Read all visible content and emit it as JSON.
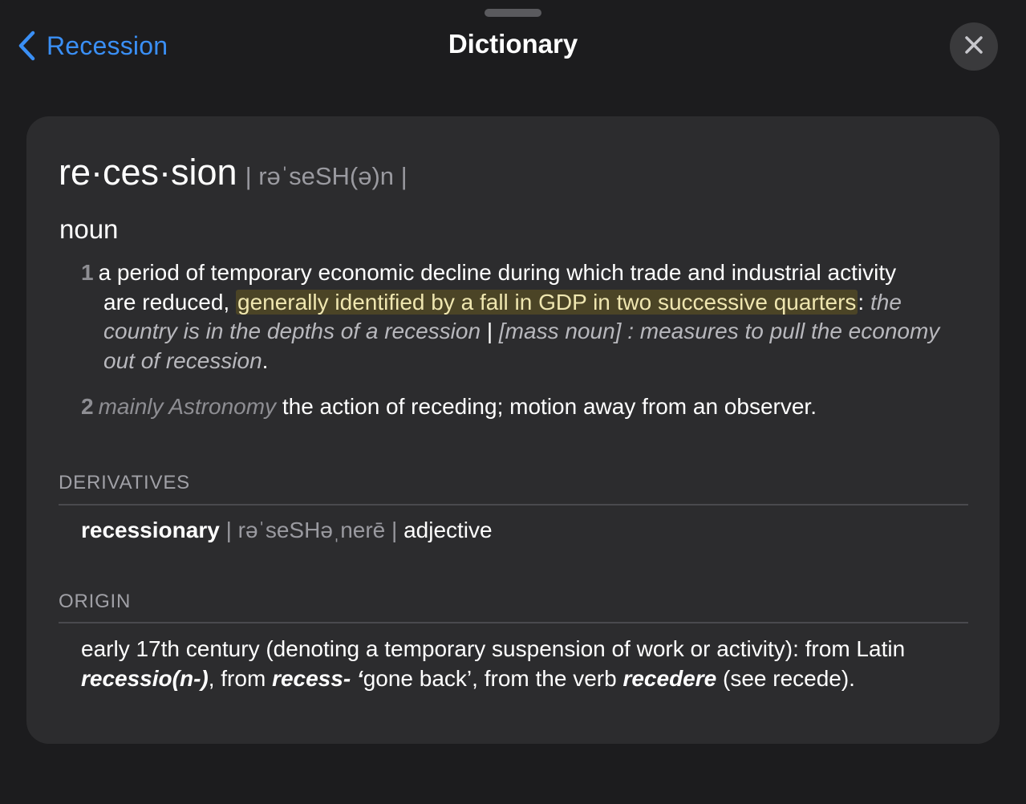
{
  "nav": {
    "back_label": "Recession",
    "title": "Dictionary"
  },
  "entry": {
    "headword": "re·ces·sion",
    "pronunciation": "| rəˈseSH(ə)n |",
    "part_of_speech": "noun",
    "senses": [
      {
        "number": "1",
        "definition_start": "a period of temporary economic decline during which trade and industrial activity",
        "definition_cont": "are reduced, ",
        "highlighted": "generally identified by a fall in GDP in two successive quarters",
        "after_highlight": ": ",
        "example_1": "the country is in the depths of a recession",
        "separator": " | ",
        "example_2": "[mass noun] : measures to pull the economy out of recession",
        "end": "."
      },
      {
        "number": "2",
        "label": "mainly Astronomy",
        "definition": " the action of receding; motion away from an observer."
      }
    ]
  },
  "derivatives": {
    "title": "DERIVATIVES",
    "word": "recessionary",
    "pronunciation": " | rəˈseSHəˌnerē | ",
    "part_of_speech": "adjective"
  },
  "origin": {
    "title": "ORIGIN",
    "text_1": "early 17th century (denoting a temporary suspension of work or activity): from Latin ",
    "term_1": "recessio(n-)",
    "text_2": ", from ",
    "term_2": "recess- ‘",
    "text_3": "gone back",
    "term_3": "’",
    "text_4": ", from the verb ",
    "term_4": "recedere",
    "text_5": " (see recede)."
  },
  "colors": {
    "background": "#1c1c1e",
    "card": "#2c2c2e",
    "accent": "#3a8ff5",
    "highlight": "#4b4426"
  },
  "icons": {
    "back": "chevron-left-icon",
    "close": "close-icon"
  }
}
